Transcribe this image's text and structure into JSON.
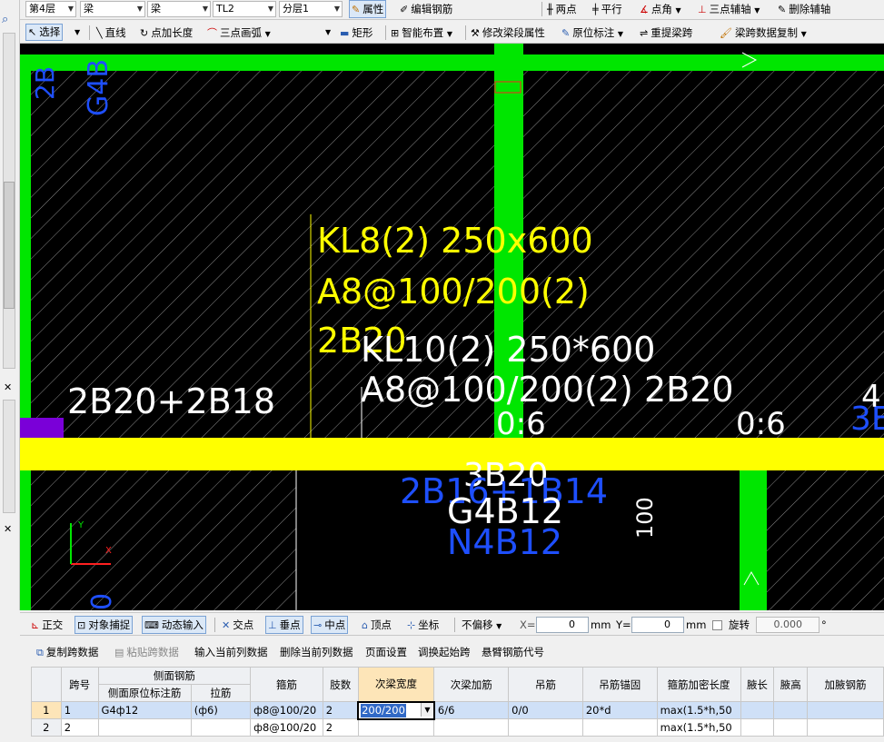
{
  "toolbar1": {
    "floor": "第4层",
    "type1": "梁",
    "type2": "梁",
    "member": "TL2",
    "layer": "分层1",
    "properties": "属性",
    "edit_rebar": "编辑钢筋",
    "two_points": "两点",
    "parallel": "平行",
    "point_angle": "点角",
    "three_point_axis": "三点辅轴",
    "delete_axis": "删除辅轴"
  },
  "toolbar2": {
    "select": "选择",
    "line": "直线",
    "point_extend": "点加长度",
    "three_point_arc": "三点画弧",
    "rect": "矩形",
    "smart_layout": "智能布置",
    "modify_span": "修改梁段属性",
    "in_situ_mark": "原位标注",
    "re_extract_span": "重提梁跨",
    "span_copy": "梁跨数据复制"
  },
  "canvas": {
    "label_top1": "2B",
    "label_top2": "G4B",
    "kl8_1": "KL8(2) 250x600",
    "kl8_2": "A8@100/200(2)",
    "kl8_3": "2B20",
    "kl10_1": "KL10(2) 250*600",
    "kl10_2": "A8@100/200(2) 2B20",
    "left_label": "2B20+2B18",
    "mid_06a": "0:6",
    "mid_06b": "0:6",
    "b_3b20": "3B20",
    "b_2b16": "2B16+1B14",
    "b_g4b12": "G4B12",
    "b_n4b12": "N4B12",
    "v100": "100",
    "right_edge": "3E",
    "right_edge2": "4",
    "axis_x": "X",
    "axis_y": "Y",
    "bottom_zero": "0",
    "colors": {
      "green": "#00e600",
      "yellow": "#ffff00",
      "white": "#ffffff",
      "blue": "#1e4fff",
      "magenta": "#ff40ff",
      "red": "#ff2020",
      "bg": "#000000"
    }
  },
  "statusbar": {
    "ortho": "正交",
    "snap": "对象捕捉",
    "dynamic_input": "动态输入",
    "intersect": "交点",
    "perpendicular": "垂点",
    "midpoint": "中点",
    "vertex": "顶点",
    "coord": "坐标",
    "offset_mode": "不偏移",
    "x_label": "X=",
    "x_value": "0",
    "y_label": "Y=",
    "y_value": "0",
    "unit": "mm",
    "rotate": "旋转",
    "rotate_value": "0.000",
    "deg": "°"
  },
  "gridbar": {
    "copy_span": "复制跨数据",
    "paste_span": "粘贴跨数据",
    "input_current_col": "输入当前列数据",
    "delete_current_col": "删除当前列数据",
    "page_setup": "页面设置",
    "swap_start_span": "调换起始跨",
    "cantilever_code": "悬臂钢筋代号"
  },
  "table": {
    "headers": {
      "span_no": "跨号",
      "side_rebar": "侧面钢筋",
      "side_mark": "侧面原位标注筋",
      "tie": "拉筋",
      "stirrup": "箍筋",
      "legs": "肢数",
      "sub_width": "次梁宽度",
      "sub_add": "次梁加筋",
      "hanger": "吊筋",
      "hanger_anchor": "吊筋锚固",
      "stirrup_dense": "箍筋加密长度",
      "haunch_len": "腋长",
      "haunch_h": "腋高",
      "haunch_rebar": "加腋钢筋"
    },
    "rows": [
      {
        "idx": "1",
        "span": "1",
        "side_mark": "G4ф12",
        "tie": "(ф6)",
        "stirrup": "ф8@100/20",
        "legs": "2",
        "sub_width": "200/200",
        "sub_add": "6/6",
        "hanger": "0/0",
        "hanger_anchor": "20*d",
        "dense": "max(1.5*h,50"
      },
      {
        "idx": "2",
        "span": "2",
        "side_mark": "",
        "tie": "",
        "stirrup": "ф8@100/20",
        "legs": "2",
        "sub_width": "",
        "sub_add": "",
        "hanger": "",
        "hanger_anchor": "",
        "dense": "max(1.5*h,50"
      }
    ]
  }
}
